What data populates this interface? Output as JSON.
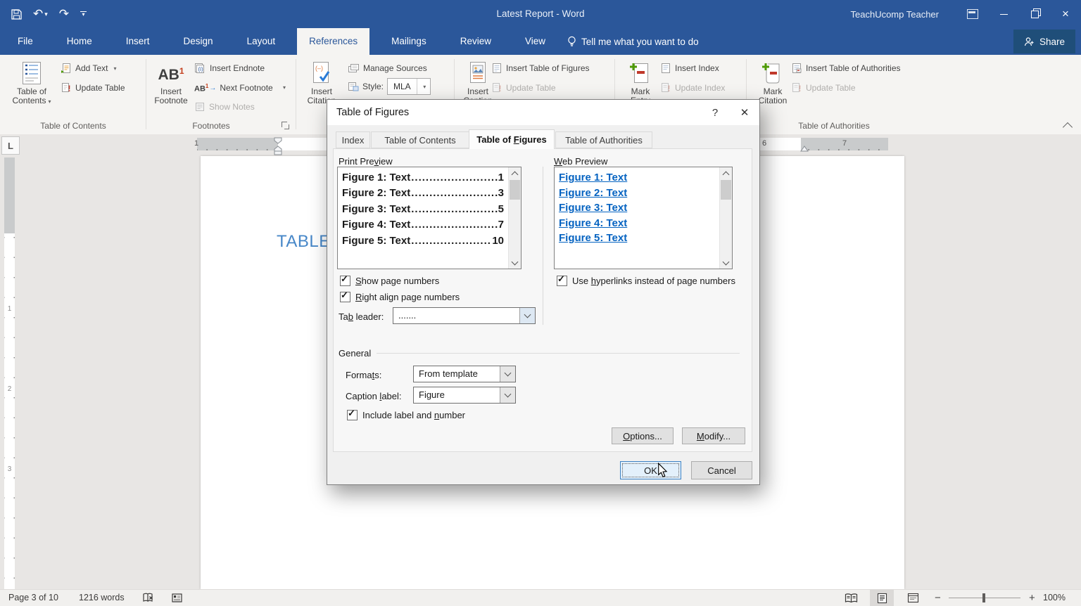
{
  "glyphs": {
    "check": "✓",
    "dd": "▾",
    "undo": "↶",
    "redo": "↷",
    "help": "?",
    "close": "✕",
    "win_close": "×"
  },
  "titlebar": {
    "title": "Latest Report - Word",
    "user": "TeachUcomp Teacher"
  },
  "tabs": {
    "items": [
      "File",
      "Home",
      "Insert",
      "Design",
      "Layout",
      "References",
      "Mailings",
      "Review",
      "View"
    ],
    "active": "References",
    "tellme": "Tell me what you want to do",
    "share": "Share"
  },
  "ribbon": {
    "toc": {
      "label": "Table of Contents",
      "big1": "Table of",
      "big2": "Contents",
      "add_text": "Add Text",
      "update_table": "Update Table"
    },
    "footnotes": {
      "label": "Footnotes",
      "ab": "AB",
      "ab_sup": "1",
      "big1": "Insert",
      "big2": "Footnote",
      "insert_endnote": "Insert Endnote",
      "next_footnote": "Next Footnote",
      "show_notes": "Show Notes"
    },
    "citations": {
      "big1": "Insert",
      "big2": "Citation",
      "manage_sources": "Manage Sources",
      "style_label": "Style:",
      "style_value": "MLA"
    },
    "captions": {
      "big1": "Insert",
      "big2": "Caption",
      "insert_tof": "Insert Table of Figures",
      "update_table": "Update Table"
    },
    "index": {
      "big1": "Mark",
      "big2": "Entry",
      "insert_index": "Insert Index",
      "update_index": "Update Index"
    },
    "authorities": {
      "label": "Table of Authorities",
      "big1": "Mark",
      "big2": "Citation",
      "insert_toa": "Insert Table of Authorities",
      "update_table": "Update Table"
    }
  },
  "ruler": {
    "tab": "L",
    "h1": "1",
    "h6": "6",
    "h7": "7",
    "v1": "1",
    "v2": "2",
    "v3": "3"
  },
  "document": {
    "heading": "TABLE"
  },
  "dialog": {
    "title": "Table of Figures",
    "tabs": [
      "Index",
      "Table of Contents",
      "Table of _F_igures",
      "Table of Authorities"
    ],
    "print_preview_label": "Print Pre_v_iew",
    "print_entries": [
      {
        "label": "Figure 1: Text",
        "page": "1"
      },
      {
        "label": "Figure 2: Text",
        "page": "3"
      },
      {
        "label": "Figure 3: Text",
        "page": "5"
      },
      {
        "label": "Figure 4: Text",
        "page": "7"
      },
      {
        "label": "Figure 5: Text",
        "page": "10"
      }
    ],
    "web_preview_label": "_W_eb Preview",
    "web_entries": [
      "Figure 1: Text",
      "Figure 2: Text",
      "Figure 3: Text",
      "Figure 4: Text",
      "Figure 5: Text"
    ],
    "show_page_numbers": "_S_how page numbers",
    "right_align": "_R_ight align page numbers",
    "tab_leader_label": "Ta_b_ leader:",
    "tab_leader_value": ".......",
    "use_hyperlinks": "Use _h_yperlinks instead of page numbers",
    "general_label": "General",
    "formats_label": "Forma_t_s:",
    "formats_value": "From template",
    "caption_label_label": "Caption _l_abel:",
    "caption_label_value": "Figure",
    "include_label": "Include label and _n_umber",
    "options_btn": "_O_ptions...",
    "modify_btn": "_M_odify...",
    "ok_btn": "OK",
    "cancel_btn": "Cancel"
  },
  "statusbar": {
    "page": "Page 3 of 10",
    "words": "1216 words",
    "zoom": "100%"
  }
}
